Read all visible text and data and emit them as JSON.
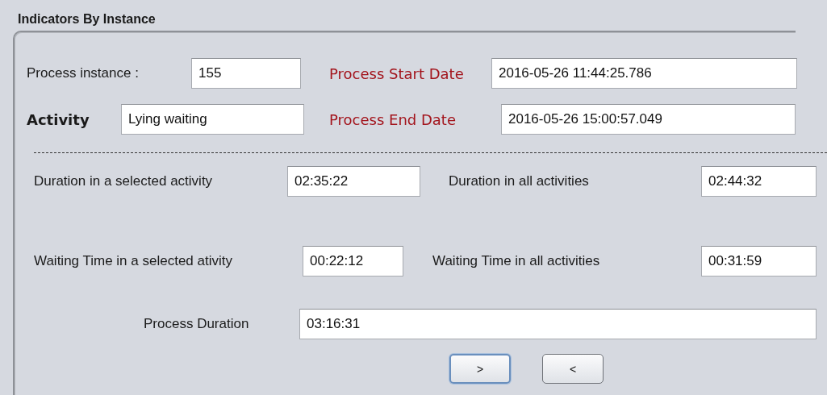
{
  "panel": {
    "title": "Indicators By Instance"
  },
  "rows": [
    {
      "fields": [
        {
          "label": "Process instance :",
          "kind": "plain",
          "value": "155"
        },
        {
          "label": "Process Start Date",
          "kind": "accent",
          "value": "2016-05-26 11:44:25.786"
        }
      ]
    },
    {
      "fields": [
        {
          "label": "Activity",
          "kind": "bold",
          "value": "Lying waiting"
        },
        {
          "label": "Process End Date",
          "kind": "accent",
          "value": "2016-05-26 15:00:57.049"
        }
      ]
    },
    {
      "fields": [
        {
          "label": "Duration in a selected activity",
          "kind": "plain",
          "value": "02:35:22"
        },
        {
          "label": "Duration in all activities",
          "kind": "plain",
          "value": "02:44:32"
        }
      ]
    },
    {
      "fields": [
        {
          "label": "Waiting Time in a selected ativity",
          "kind": "plain",
          "value": "00:22:12"
        },
        {
          "label": "Waiting Time in all activities",
          "kind": "plain",
          "value": "00:31:59"
        }
      ]
    },
    {
      "fields": [
        {
          "label": "Process Duration",
          "kind": "plain",
          "value": "03:16:31"
        }
      ]
    }
  ],
  "buttons": [
    {
      "label": ">",
      "focused": true
    },
    {
      "label": "<",
      "focused": false
    }
  ]
}
